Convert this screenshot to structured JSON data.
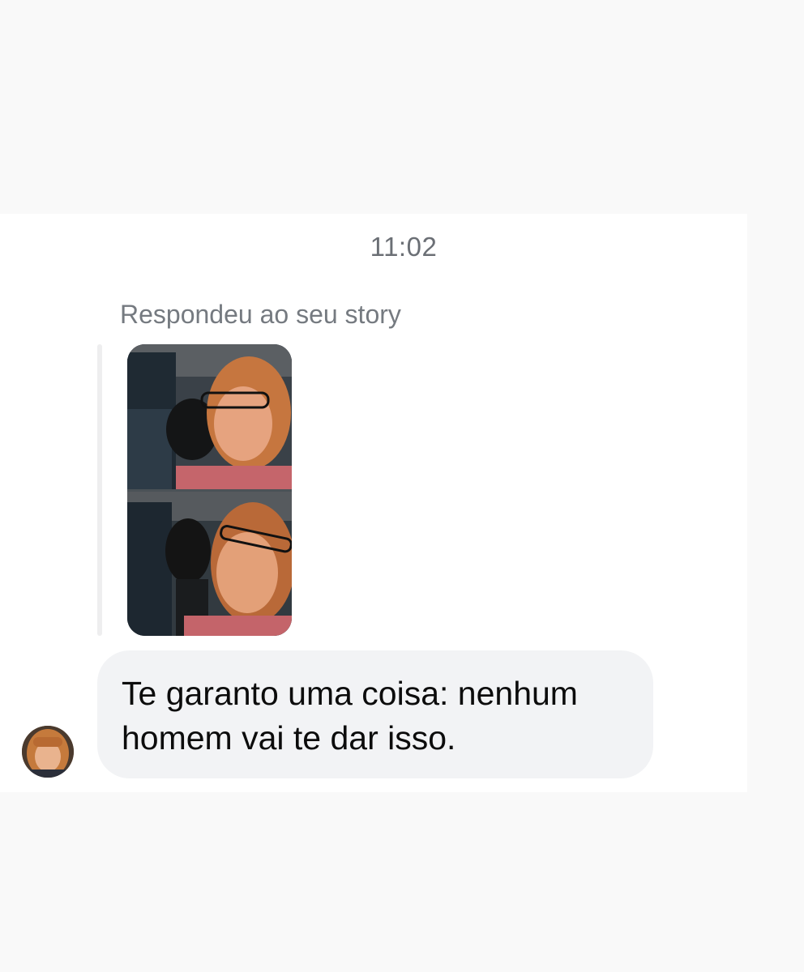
{
  "conversation": {
    "timestamp": "11:02",
    "story_reply": {
      "caption": "Respondeu ao seu story",
      "thumbnail": "story-photo: two stacked selfies of a woman with glasses and a small black dog in a car"
    },
    "message": {
      "line1": "Te garanto uma coisa: nenhum",
      "line2": "homem vai te dar isso."
    },
    "sender_avatar": "avatar-photo"
  },
  "colors": {
    "page_background": "#f9f9f9",
    "panel_background": "#ffffff",
    "bubble_background": "#f2f3f5",
    "meta_text": "#6b6f75",
    "message_text": "#0c0c0c"
  }
}
